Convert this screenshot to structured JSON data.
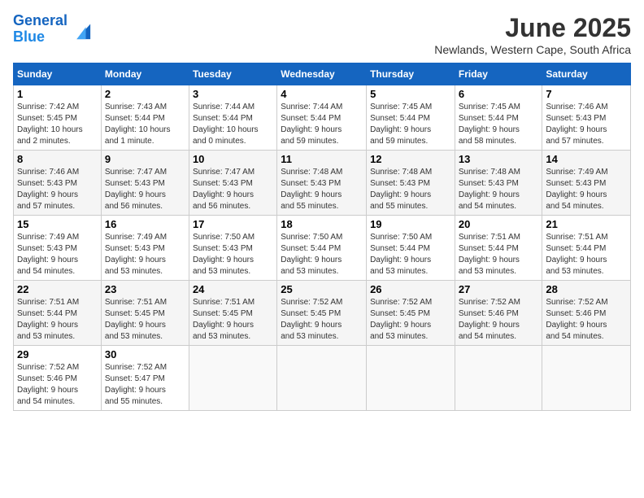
{
  "header": {
    "logo_line1": "General",
    "logo_line2": "Blue",
    "month": "June 2025",
    "location": "Newlands, Western Cape, South Africa"
  },
  "columns": [
    "Sunday",
    "Monday",
    "Tuesday",
    "Wednesday",
    "Thursday",
    "Friday",
    "Saturday"
  ],
  "weeks": [
    [
      {
        "day": "1",
        "lines": [
          "Sunrise: 7:42 AM",
          "Sunset: 5:45 PM",
          "Daylight: 10 hours",
          "and 2 minutes."
        ]
      },
      {
        "day": "2",
        "lines": [
          "Sunrise: 7:43 AM",
          "Sunset: 5:44 PM",
          "Daylight: 10 hours",
          "and 1 minute."
        ]
      },
      {
        "day": "3",
        "lines": [
          "Sunrise: 7:44 AM",
          "Sunset: 5:44 PM",
          "Daylight: 10 hours",
          "and 0 minutes."
        ]
      },
      {
        "day": "4",
        "lines": [
          "Sunrise: 7:44 AM",
          "Sunset: 5:44 PM",
          "Daylight: 9 hours",
          "and 59 minutes."
        ]
      },
      {
        "day": "5",
        "lines": [
          "Sunrise: 7:45 AM",
          "Sunset: 5:44 PM",
          "Daylight: 9 hours",
          "and 59 minutes."
        ]
      },
      {
        "day": "6",
        "lines": [
          "Sunrise: 7:45 AM",
          "Sunset: 5:44 PM",
          "Daylight: 9 hours",
          "and 58 minutes."
        ]
      },
      {
        "day": "7",
        "lines": [
          "Sunrise: 7:46 AM",
          "Sunset: 5:43 PM",
          "Daylight: 9 hours",
          "and 57 minutes."
        ]
      }
    ],
    [
      {
        "day": "8",
        "lines": [
          "Sunrise: 7:46 AM",
          "Sunset: 5:43 PM",
          "Daylight: 9 hours",
          "and 57 minutes."
        ]
      },
      {
        "day": "9",
        "lines": [
          "Sunrise: 7:47 AM",
          "Sunset: 5:43 PM",
          "Daylight: 9 hours",
          "and 56 minutes."
        ]
      },
      {
        "day": "10",
        "lines": [
          "Sunrise: 7:47 AM",
          "Sunset: 5:43 PM",
          "Daylight: 9 hours",
          "and 56 minutes."
        ]
      },
      {
        "day": "11",
        "lines": [
          "Sunrise: 7:48 AM",
          "Sunset: 5:43 PM",
          "Daylight: 9 hours",
          "and 55 minutes."
        ]
      },
      {
        "day": "12",
        "lines": [
          "Sunrise: 7:48 AM",
          "Sunset: 5:43 PM",
          "Daylight: 9 hours",
          "and 55 minutes."
        ]
      },
      {
        "day": "13",
        "lines": [
          "Sunrise: 7:48 AM",
          "Sunset: 5:43 PM",
          "Daylight: 9 hours",
          "and 54 minutes."
        ]
      },
      {
        "day": "14",
        "lines": [
          "Sunrise: 7:49 AM",
          "Sunset: 5:43 PM",
          "Daylight: 9 hours",
          "and 54 minutes."
        ]
      }
    ],
    [
      {
        "day": "15",
        "lines": [
          "Sunrise: 7:49 AM",
          "Sunset: 5:43 PM",
          "Daylight: 9 hours",
          "and 54 minutes."
        ]
      },
      {
        "day": "16",
        "lines": [
          "Sunrise: 7:49 AM",
          "Sunset: 5:43 PM",
          "Daylight: 9 hours",
          "and 53 minutes."
        ]
      },
      {
        "day": "17",
        "lines": [
          "Sunrise: 7:50 AM",
          "Sunset: 5:43 PM",
          "Daylight: 9 hours",
          "and 53 minutes."
        ]
      },
      {
        "day": "18",
        "lines": [
          "Sunrise: 7:50 AM",
          "Sunset: 5:44 PM",
          "Daylight: 9 hours",
          "and 53 minutes."
        ]
      },
      {
        "day": "19",
        "lines": [
          "Sunrise: 7:50 AM",
          "Sunset: 5:44 PM",
          "Daylight: 9 hours",
          "and 53 minutes."
        ]
      },
      {
        "day": "20",
        "lines": [
          "Sunrise: 7:51 AM",
          "Sunset: 5:44 PM",
          "Daylight: 9 hours",
          "and 53 minutes."
        ]
      },
      {
        "day": "21",
        "lines": [
          "Sunrise: 7:51 AM",
          "Sunset: 5:44 PM",
          "Daylight: 9 hours",
          "and 53 minutes."
        ]
      }
    ],
    [
      {
        "day": "22",
        "lines": [
          "Sunrise: 7:51 AM",
          "Sunset: 5:44 PM",
          "Daylight: 9 hours",
          "and 53 minutes."
        ]
      },
      {
        "day": "23",
        "lines": [
          "Sunrise: 7:51 AM",
          "Sunset: 5:45 PM",
          "Daylight: 9 hours",
          "and 53 minutes."
        ]
      },
      {
        "day": "24",
        "lines": [
          "Sunrise: 7:51 AM",
          "Sunset: 5:45 PM",
          "Daylight: 9 hours",
          "and 53 minutes."
        ]
      },
      {
        "day": "25",
        "lines": [
          "Sunrise: 7:52 AM",
          "Sunset: 5:45 PM",
          "Daylight: 9 hours",
          "and 53 minutes."
        ]
      },
      {
        "day": "26",
        "lines": [
          "Sunrise: 7:52 AM",
          "Sunset: 5:45 PM",
          "Daylight: 9 hours",
          "and 53 minutes."
        ]
      },
      {
        "day": "27",
        "lines": [
          "Sunrise: 7:52 AM",
          "Sunset: 5:46 PM",
          "Daylight: 9 hours",
          "and 54 minutes."
        ]
      },
      {
        "day": "28",
        "lines": [
          "Sunrise: 7:52 AM",
          "Sunset: 5:46 PM",
          "Daylight: 9 hours",
          "and 54 minutes."
        ]
      }
    ],
    [
      {
        "day": "29",
        "lines": [
          "Sunrise: 7:52 AM",
          "Sunset: 5:46 PM",
          "Daylight: 9 hours",
          "and 54 minutes."
        ]
      },
      {
        "day": "30",
        "lines": [
          "Sunrise: 7:52 AM",
          "Sunset: 5:47 PM",
          "Daylight: 9 hours",
          "and 55 minutes."
        ]
      },
      {
        "day": "",
        "lines": []
      },
      {
        "day": "",
        "lines": []
      },
      {
        "day": "",
        "lines": []
      },
      {
        "day": "",
        "lines": []
      },
      {
        "day": "",
        "lines": []
      }
    ]
  ]
}
